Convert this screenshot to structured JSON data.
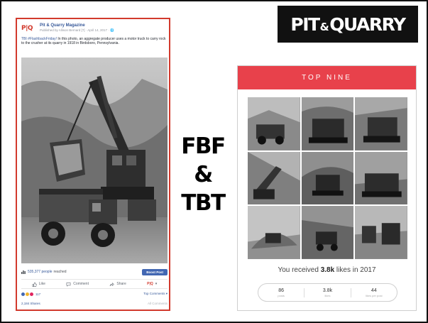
{
  "brand": {
    "prefix": "PIT",
    "amp": "&",
    "suffix": "QUARRY"
  },
  "post": {
    "page_logo": "P|Q",
    "page_name": "Pit & Quarry Magazine",
    "meta": "Published by Allison Bernard [?] · April 14, 2017 · 🌐",
    "caption_tag": "TBI #FlashbackFriday!",
    "caption": " In this photo, an aggregate producer uses a motor truck to carry rock to the crusher at its quarry in 1918 in Birdsboro, Pennsylvania.",
    "reach_count": "535,377 people",
    "reach_suffix": "reached",
    "boost_label": "Boost Post",
    "actions": {
      "like": "Like",
      "comment": "Comment",
      "share": "Share"
    },
    "reactions_count": "117",
    "top_comments": "Top Comments ▾",
    "shares": "2,184 Shares",
    "all_comments": "All Comments"
  },
  "center": {
    "line1": "FBF",
    "line2": "&",
    "line3": "TBT"
  },
  "top_nine": {
    "header": "TOP NINE",
    "likes_prefix": "You received ",
    "likes_value": "3.8k",
    "likes_suffix": " likes in 2017",
    "stats": [
      {
        "value": "86",
        "label": "posts"
      },
      {
        "value": "3.8k",
        "label": "likes"
      },
      {
        "value": "44",
        "label": "likes per post"
      }
    ]
  },
  "colors": {
    "accent_red": "#d23a2d",
    "header_red": "#e8414b",
    "fb_blue": "#365899",
    "boost_blue": "#4267b2"
  }
}
